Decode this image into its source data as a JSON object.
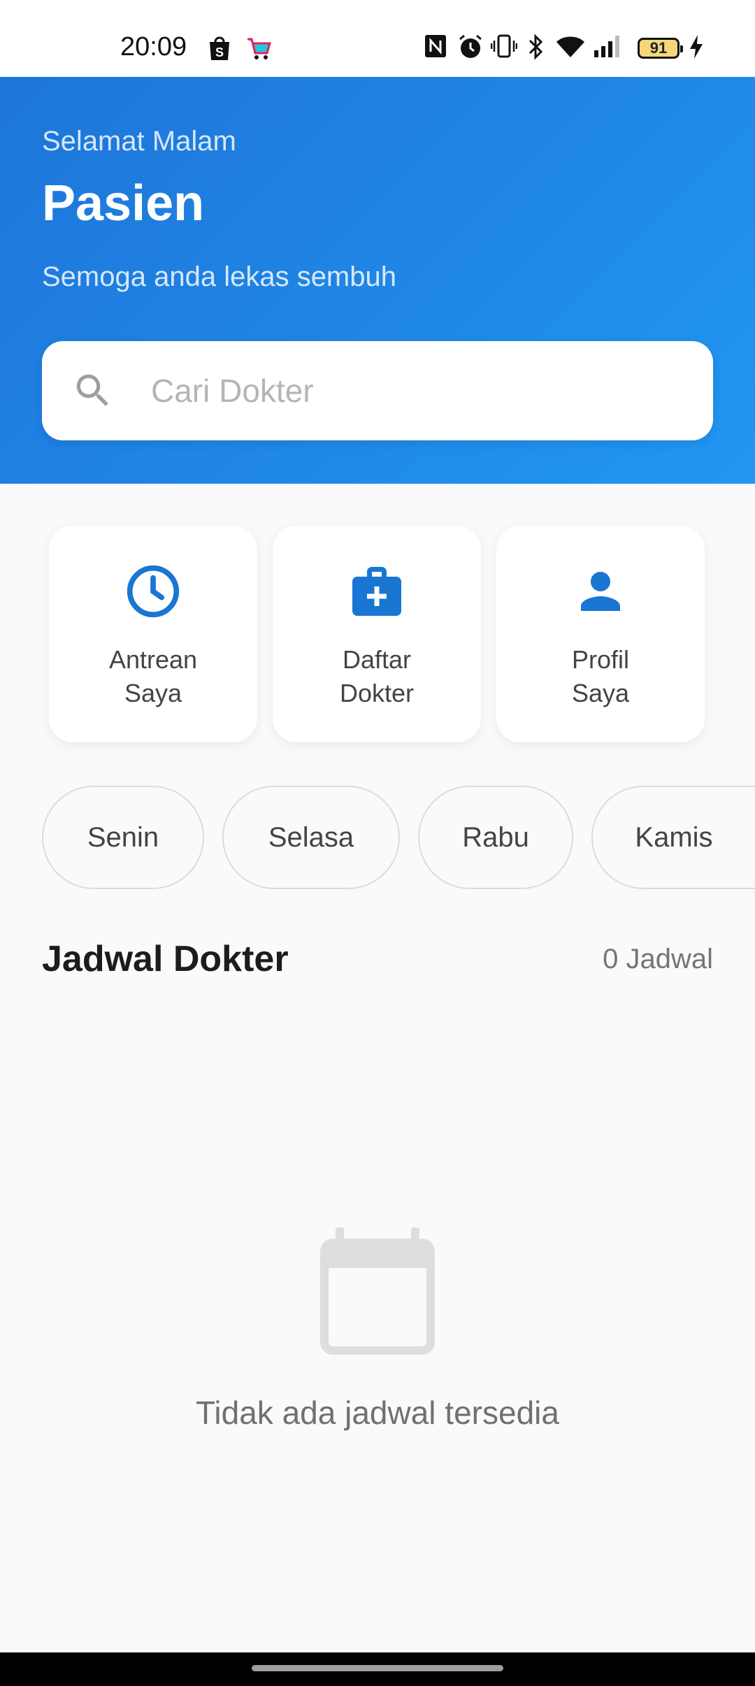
{
  "status_bar": {
    "time": "20:09",
    "battery": "91",
    "icons": [
      "shopee-icon",
      "cart-icon",
      "nfc-icon",
      "alarm-icon",
      "vibrate-icon",
      "bluetooth-icon",
      "wifi-icon",
      "signal-icon",
      "battery-icon",
      "charging-icon"
    ]
  },
  "header": {
    "greeting": "Selamat Malam",
    "name": "Pasien",
    "subtitle": "Semoga anda lekas sembuh"
  },
  "search": {
    "placeholder": "Cari Dokter",
    "value": ""
  },
  "quick_actions": [
    {
      "label": "Antrean\nSaya",
      "icon": "clock-icon"
    },
    {
      "label": "Daftar\nDokter",
      "icon": "medical-bag-icon"
    },
    {
      "label": "Profil\nSaya",
      "icon": "person-icon"
    }
  ],
  "days": [
    "Senin",
    "Selasa",
    "Rabu",
    "Kamis"
  ],
  "schedule": {
    "title": "Jadwal Dokter",
    "count": "0 Jadwal",
    "empty_text": "Tidak ada jadwal tersedia",
    "empty_icon": "calendar-icon"
  },
  "colors": {
    "primary": "#1976d2",
    "header_gradient_start": "#1e75d8",
    "header_gradient_end": "#2196f3",
    "background": "#fafafa"
  }
}
